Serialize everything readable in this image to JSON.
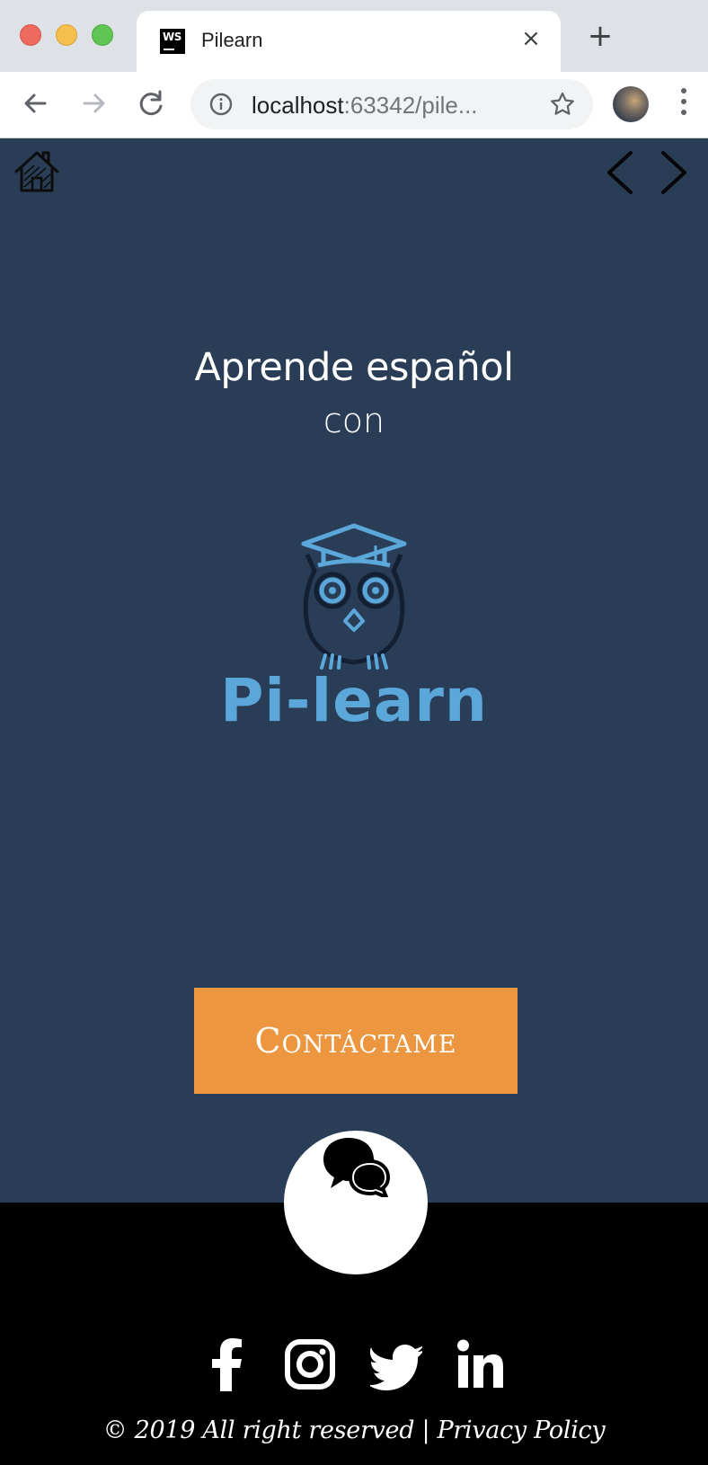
{
  "browser": {
    "tab": {
      "title": "Pilearn",
      "favicon_text": "WS",
      "close_glyph": "×"
    },
    "new_tab_glyph": "+",
    "address": {
      "host": "localhost",
      "rest": ":63342/pile..."
    }
  },
  "page": {
    "headline": "Aprende español",
    "subline": "con",
    "brand": "Pi-learn",
    "cta_label": "Contáctame",
    "copyright": "© 2019 All right reserved | Privacy Policy",
    "colors": {
      "hero_bg": "#293d57",
      "accent": "#ec9640",
      "brand": "#5ba7d9",
      "footer_bg": "#000000"
    },
    "social": [
      "facebook-icon",
      "instagram-icon",
      "twitter-icon",
      "linkedin-icon"
    ]
  }
}
